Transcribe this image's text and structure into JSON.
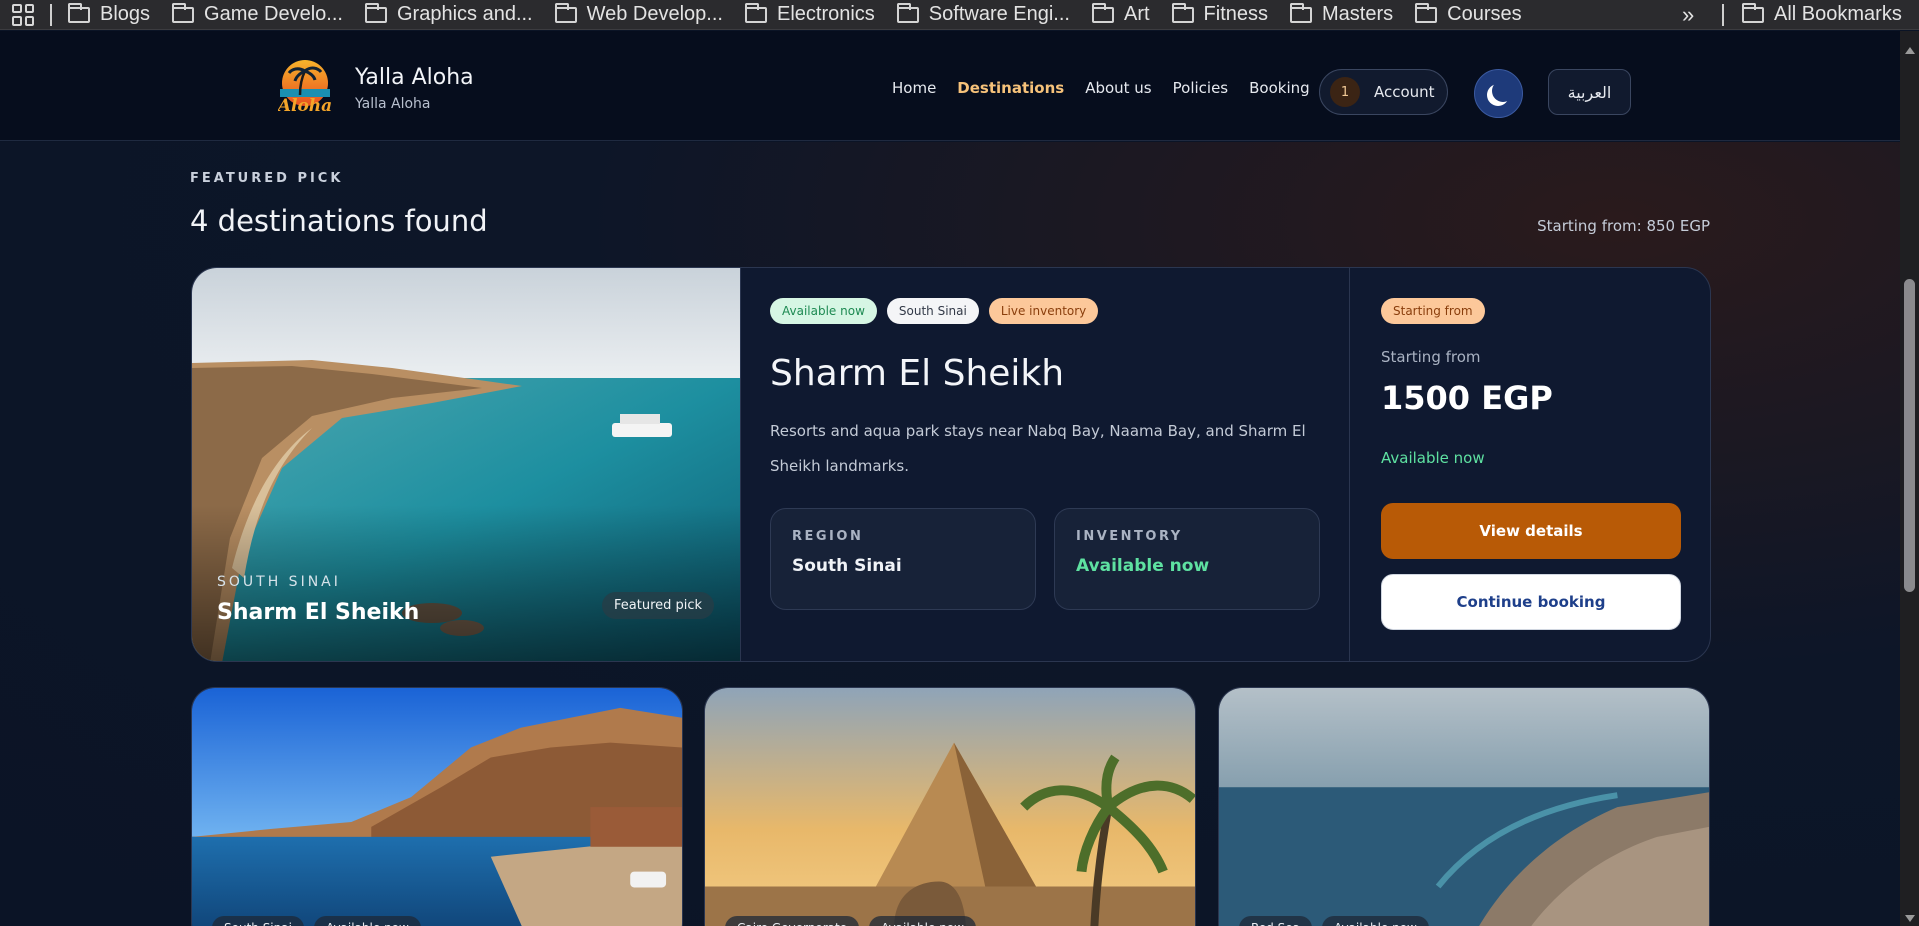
{
  "bookmarks": {
    "items": [
      "Blogs",
      "Game Develo...",
      "Graphics and...",
      "Web Develop...",
      "Electronics",
      "Software Engi...",
      "Art",
      "Fitness",
      "Masters",
      "Courses"
    ],
    "more": "»",
    "all": "All Bookmarks"
  },
  "header": {
    "brand_title": "Yalla Aloha",
    "brand_sub": "Yalla Aloha",
    "logo_text": "Aloha",
    "nav": [
      "Home",
      "Destinations",
      "About us",
      "Policies",
      "Booking"
    ],
    "active_nav": "Destinations",
    "account_count": "1",
    "account_label": "Account",
    "lang_label": "العربية"
  },
  "results": {
    "eyebrow": "FEATURED PICK",
    "title": "4 destinations found",
    "starting_note": "Starting from: 850 EGP"
  },
  "featured": {
    "image_region": "SOUTH SINAI",
    "image_title": "Sharm El Sheikh",
    "image_pill": "Featured pick",
    "tags": [
      "Available now",
      "South Sinai",
      "Live inventory"
    ],
    "title": "Sharm El Sheikh",
    "description": "Resorts and aqua park stays near Nabq Bay, Naama Bay, and Sharm El Sheikh landmarks.",
    "region_label": "REGION",
    "region_value": "South Sinai",
    "inventory_label": "INVENTORY",
    "inventory_value": "Available now",
    "price_tag": "Starting from",
    "price_label": "Starting from",
    "price": "1500 EGP",
    "availability": "Available now",
    "view_details": "View details",
    "continue_booking": "Continue booking"
  },
  "cards": [
    {
      "tags": [
        "South Sinai",
        "Available now"
      ]
    },
    {
      "tags": [
        "Cairo Governorate",
        "Available now"
      ]
    },
    {
      "tags": [
        "Red Sea",
        "Available now"
      ]
    }
  ],
  "colors": {
    "accent_orange": "#b85a06",
    "active_nav": "#f6c27a",
    "available_green": "#5ee1a1",
    "page_bg": "#0b1426"
  }
}
